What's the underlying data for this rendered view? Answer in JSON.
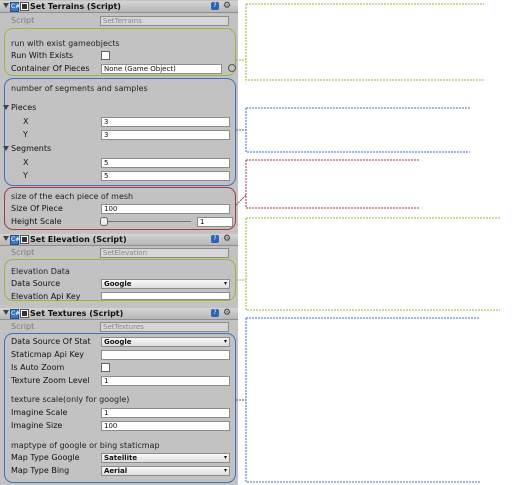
{
  "components": {
    "set_terrains": {
      "title": "Set Terrains (Script)",
      "script_label": "Script",
      "script_value": "SetTerrains",
      "group1_comment": "run with exist gameobjects",
      "run_with_exists_label": "Run With Exists",
      "container_label": "Container Of Pieces",
      "container_value": "None (Game Object)",
      "group2_comment": "number of segments and samples",
      "pieces_label": "Pieces",
      "pieces_x_label": "X",
      "pieces_x_value": "3",
      "pieces_y_label": "Y",
      "pieces_y_value": "3",
      "segments_label": "Segments",
      "segments_x_label": "X",
      "segments_x_value": "5",
      "segments_y_label": "Y",
      "segments_y_value": "5",
      "group3_comment": "size of the each piece of mesh",
      "size_label": "Size Of Piece",
      "size_value": "100",
      "height_scale_label": "Height Scale",
      "height_scale_value": "1"
    },
    "set_elevation": {
      "title": "Set Elevation (Script)",
      "script_label": "Script",
      "script_value": "SetElevation",
      "section_label": "Elevation Data",
      "data_source_label": "Data Source",
      "data_source_value": "Google",
      "api_key_label": "Elevation Api Key"
    },
    "set_textures": {
      "title": "Set Textures (Script)",
      "script_label": "Script",
      "script_value": "SetTextures",
      "data_source_label": "Data Source Of Stat",
      "data_source_value": "Google",
      "staticmap_key_label": "Staticmap Api Key",
      "auto_zoom_label": "Is Auto Zoom",
      "zoom_level_label": "Texture Zoom Level",
      "zoom_level_value": "1",
      "scale_comment": "texture scale(only for google)",
      "imagine_scale_label": "Imagine Scale",
      "imagine_scale_value": "1",
      "imagine_size_label": "Imagine Size",
      "imagine_size_value": "100",
      "maptype_comment": "maptype of google or bing staticmap",
      "map_type_google_label": "Map Type Google",
      "map_type_google_value": "Satellite",
      "map_type_bing_label": "Map Type Bing",
      "map_type_bing_value": "Aerial"
    }
  },
  "icons": {
    "script": "C#",
    "help": "?",
    "gear": "⚙",
    "dropdown": "▾"
  },
  "colors": {
    "green_annotation": "#9ab53c",
    "blue_annotation": "#3f6fc2",
    "red_annotation": "#a03c3c",
    "panel_bg": "#c2c2c2"
  }
}
